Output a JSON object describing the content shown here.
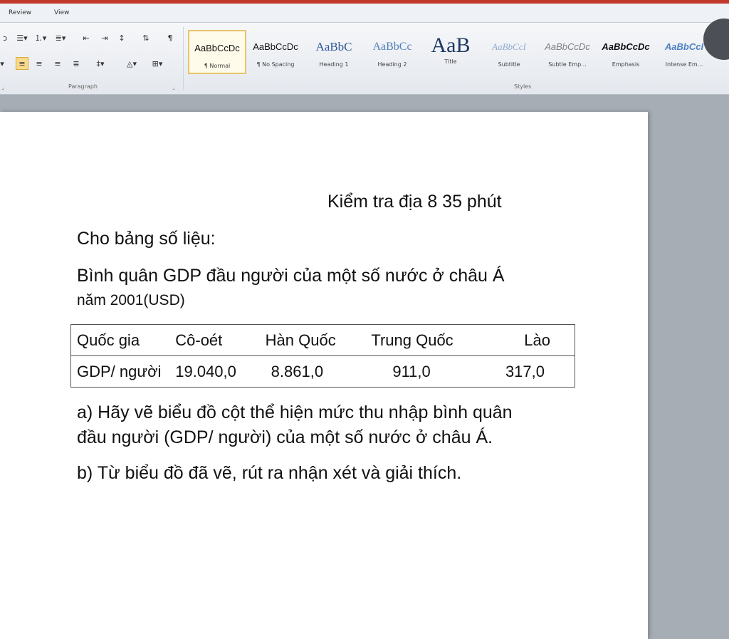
{
  "tabs": {
    "review": "Review",
    "view": "View"
  },
  "paragraph_group": {
    "label": "Paragraph",
    "icons": [
      "bullets-icon",
      "numbering-icon",
      "multilevel-list-icon",
      "decrease-indent-icon",
      "increase-indent-icon",
      "sort-icon",
      "show-marks-icon",
      "align-left-icon",
      "align-center-icon",
      "align-right-icon",
      "justify-icon",
      "line-spacing-icon",
      "shading-icon",
      "borders-icon"
    ]
  },
  "styles_group": {
    "label": "Styles",
    "items": [
      {
        "sample": "AaBbCcDc",
        "name": "¶ Normal",
        "selected": true
      },
      {
        "sample": "AaBbCcDc",
        "name": "¶ No Spacing"
      },
      {
        "sample": "AaBbC",
        "name": "Heading 1"
      },
      {
        "sample": "AaBbCc",
        "name": "Heading 2"
      },
      {
        "sample": "AaB",
        "name": "Title"
      },
      {
        "sample": "AaBbCcI",
        "name": "Subtitle"
      },
      {
        "sample": "AaBbCcDc",
        "name": "Subtle Emp..."
      },
      {
        "sample": "AaBbCcDc",
        "name": "Emphasis"
      },
      {
        "sample": "AaBbCcI",
        "name": "Intense Em..."
      }
    ]
  },
  "document": {
    "heading": "Kiểm tra địa 8 35 phút",
    "intro": "Cho bảng số liệu:",
    "caption_line1": "Bình quân GDP đầu người của một số nước ở châu Á",
    "caption_line2": "năm 2001(USD)",
    "table": {
      "header": [
        "Quốc gia",
        "Cô-oét",
        "Hàn Quốc",
        "Trung Quốc",
        "Lào"
      ],
      "row": [
        "GDP/ người",
        "19.040,0",
        "8.861,0",
        "911,0",
        "317,0"
      ]
    },
    "question_a_line1": "a) Hãy vẽ biểu đồ cột thể hiện mức thu nhập bình quân",
    "question_a_line2": "đầu người (GDP/ người) của một số nước ở châu Á.",
    "question_b": "b) Từ biểu đồ đã vẽ, rút ra nhận xét và giải thích."
  }
}
